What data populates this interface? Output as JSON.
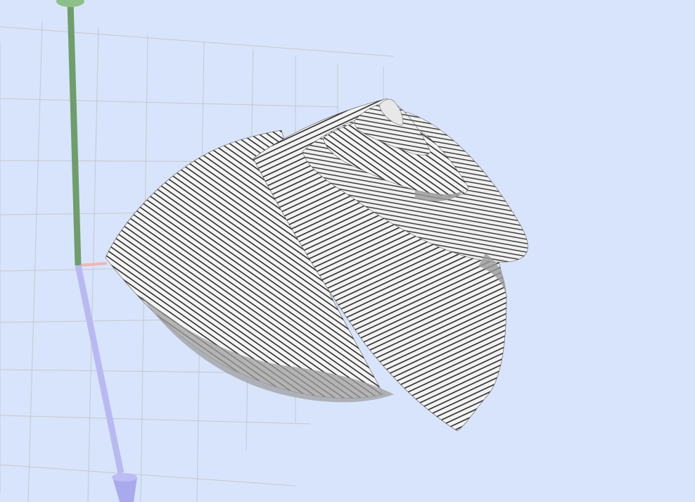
{
  "viewport": {
    "background_color": "#d8e4fb",
    "grid_color": "#c4c8cf",
    "grid_visible": true
  },
  "axes": {
    "x_axis_color": "#f0b6b6",
    "y_axis_color": "#6e9e6a",
    "z_axis_color": "#b9b9f2",
    "x_axis_icon": "x-axis-arrow-icon",
    "y_axis_icon": "y-axis-arrow-icon",
    "z_axis_icon": "z-axis-arrow-icon"
  },
  "model": {
    "shape": "spiral-shell-voxel-surface",
    "surface_color": "#f4f4f4",
    "stripe_color": "#222222",
    "shadow_color": "#9a9a9a"
  }
}
